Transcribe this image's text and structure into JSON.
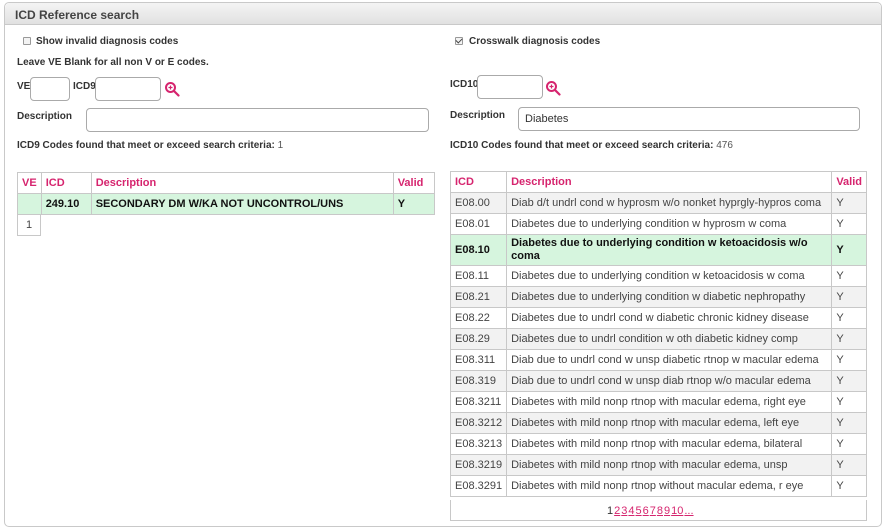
{
  "panel": {
    "title": "ICD Reference search"
  },
  "left": {
    "show_invalid_label": "Show invalid diagnosis codes",
    "show_invalid_checked": false,
    "hint": "Leave VE Blank for all non V or E codes.",
    "ve_label": "VE",
    "ve_value": "",
    "icd9_label": "ICD9",
    "icd9_value": "",
    "description_label": "Description",
    "description_value": "",
    "found_label": "ICD9 Codes found that meet or exceed search criteria:",
    "found_count": "1",
    "table": {
      "headers": {
        "ve": "VE",
        "icd": "ICD",
        "description": "Description",
        "valid": "Valid"
      },
      "rows": [
        {
          "ve": "",
          "icd": "249.10",
          "description": "SECONDARY DM W/KA NOT UNCONTROL/UNS",
          "valid": "Y"
        }
      ],
      "pager": "1"
    }
  },
  "right": {
    "crosswalk_label": "Crosswalk diagnosis codes",
    "crosswalk_checked": true,
    "icd10_label": "ICD10",
    "icd10_value": "",
    "description_label": "Description",
    "description_value": "Diabetes",
    "found_label": "ICD10 Codes found that meet or exceed search criteria:",
    "found_count": "476",
    "table": {
      "headers": {
        "icd": "ICD",
        "description": "Description",
        "valid": "Valid"
      },
      "rows": [
        {
          "icd": "E08.00",
          "description": "Diab d/t undrl cond w hyprosm w/o nonket hyprgly-hypros coma",
          "valid": "Y"
        },
        {
          "icd": "E08.01",
          "description": "Diabetes due to underlying condition w hyprosm w coma",
          "valid": "Y"
        },
        {
          "icd": "E08.10",
          "description": "Diabetes due to underlying condition w ketoacidosis w/o coma",
          "valid": "Y",
          "selected": true
        },
        {
          "icd": "E08.11",
          "description": "Diabetes due to underlying condition w ketoacidosis w coma",
          "valid": "Y"
        },
        {
          "icd": "E08.21",
          "description": "Diabetes due to underlying condition w diabetic nephropathy",
          "valid": "Y"
        },
        {
          "icd": "E08.22",
          "description": "Diabetes due to undrl cond w diabetic chronic kidney disease",
          "valid": "Y"
        },
        {
          "icd": "E08.29",
          "description": "Diabetes due to undrl condition w oth diabetic kidney comp",
          "valid": "Y"
        },
        {
          "icd": "E08.311",
          "description": "Diab due to undrl cond w unsp diabetic rtnop w macular edema",
          "valid": "Y"
        },
        {
          "icd": "E08.319",
          "description": "Diab due to undrl cond w unsp diab rtnop w/o macular edema",
          "valid": "Y"
        },
        {
          "icd": "E08.3211",
          "description": "Diabetes with mild nonp rtnop with macular edema, right eye",
          "valid": "Y"
        },
        {
          "icd": "E08.3212",
          "description": "Diabetes with mild nonp rtnop with macular edema, left eye",
          "valid": "Y"
        },
        {
          "icd": "E08.3213",
          "description": "Diabetes with mild nonp rtnop with macular edema, bilateral",
          "valid": "Y"
        },
        {
          "icd": "E08.3219",
          "description": "Diabetes with mild nonp rtnop with macular edema, unsp",
          "valid": "Y"
        },
        {
          "icd": "E08.3291",
          "description": "Diabetes with mild nonp rtnop without macular edema, r eye",
          "valid": "Y"
        }
      ],
      "pager": {
        "current": "1",
        "pages": [
          "2",
          "3",
          "4",
          "5",
          "6",
          "7",
          "8",
          "9",
          "10",
          "..."
        ]
      }
    }
  },
  "icons": {
    "search": "search-icon",
    "checkbox": "checkbox-icon"
  },
  "colors": {
    "accent": "#d6246e",
    "selected_row": "#d6f5de"
  }
}
